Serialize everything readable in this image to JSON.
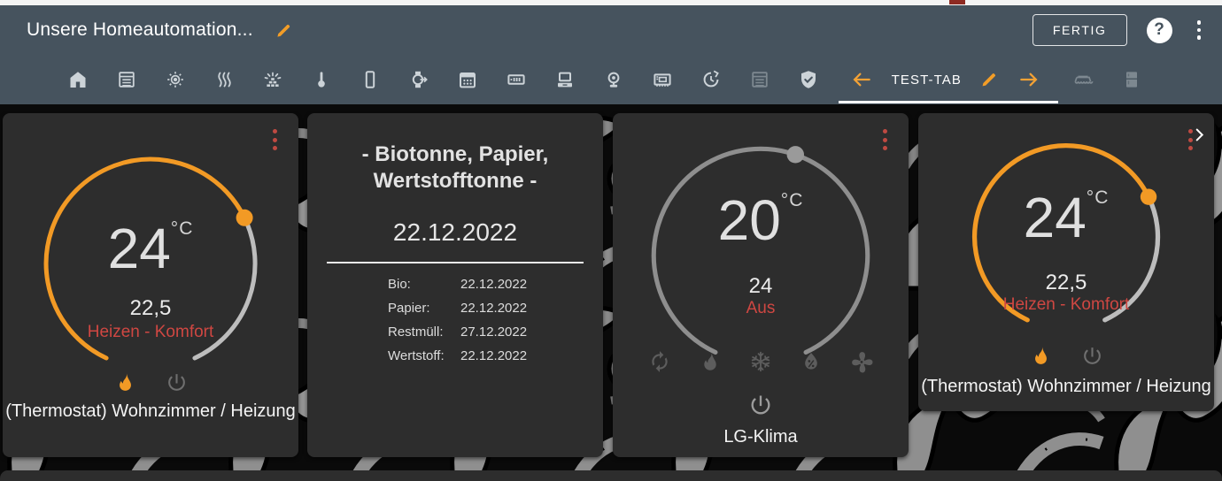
{
  "header": {
    "title": "Unsere Homeautomation...",
    "done_button": "FERTIG",
    "help_glyph": "?"
  },
  "tabs": {
    "active_label": "TEST-TAB",
    "icon_tabs": [
      "home",
      "window-shutter",
      "sun-brightness",
      "heat-waves",
      "sprinkler",
      "thermometer",
      "cellphone",
      "watch-export",
      "calendar",
      "nas",
      "desktop-computer",
      "webcam",
      "expansion-card",
      "update-clock",
      "window-shutter-dimmed",
      "shield-check"
    ],
    "trailing_icon_tabs": [
      "awning",
      "fridge"
    ]
  },
  "cards": {
    "thermostat1": {
      "current": "24",
      "unit": "°C",
      "target": "22,5",
      "mode": "Heizen - Komfort",
      "name": "(Thermostat) Wohnzimmer / Heizung"
    },
    "waste": {
      "title": "- Biotonne, Papier, Wertstofftonne -",
      "date": "22.12.2022",
      "rows": [
        {
          "label": "Bio:",
          "value": "22.12.2022"
        },
        {
          "label": "Papier:",
          "value": "22.12.2022"
        },
        {
          "label": "Restmüll:",
          "value": "27.12.2022"
        },
        {
          "label": "Wertstoff:",
          "value": "22.12.2022"
        }
      ]
    },
    "climate": {
      "current": "20",
      "unit": "°C",
      "target": "24",
      "state": "Aus",
      "name": "LG-Klima",
      "mode_icons": [
        "auto-sync",
        "heat-flame",
        "cool-snowflake",
        "dry-humidity",
        "fan-only"
      ]
    },
    "thermostat2": {
      "current": "24",
      "unit": "°C",
      "target": "22,5",
      "mode": "Heizen - Komfort",
      "name": "(Thermostat) Wohnzimmer / Heizung"
    }
  },
  "colors": {
    "accent_orange": "#f2a135",
    "app_bar": "#46535e",
    "card_background": "#2d2d2d",
    "alert_red": "#cf4742",
    "card_menu_red": "#bf4a42",
    "dial_grey": "#8e8e8e"
  }
}
